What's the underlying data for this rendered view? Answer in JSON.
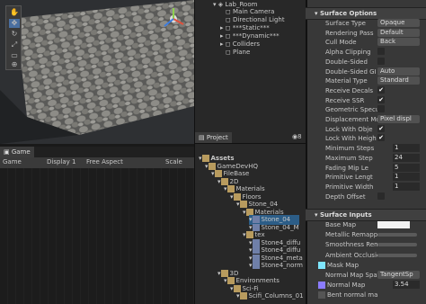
{
  "scene": {
    "tools": [
      "hand-tool",
      "move-tool",
      "rotate-tool",
      "scale-tool",
      "rect-tool",
      "transform-tool"
    ]
  },
  "game_tab": {
    "label": "Game",
    "display": "Game",
    "display_num": "Display 1",
    "aspect": "Free Aspect",
    "scale_label": "Scale"
  },
  "hierarchy": {
    "root": "Lab_Room",
    "items": [
      "Main Camera",
      "Directional Light",
      "***Static***",
      "***Dynamic***",
      "Colliders",
      "Plane"
    ]
  },
  "project": {
    "tab": "Project",
    "count": "8",
    "tree": [
      {
        "label": "Assets",
        "indent": 0,
        "bold": true
      },
      {
        "label": "GameDevHQ",
        "indent": 1
      },
      {
        "label": "FileBase",
        "indent": 2
      },
      {
        "label": "2D",
        "indent": 3
      },
      {
        "label": "Materials",
        "indent": 4
      },
      {
        "label": "Floors",
        "indent": 5
      },
      {
        "label": "Stone_04",
        "indent": 6
      },
      {
        "label": "Materials",
        "indent": 7
      },
      {
        "label": "Stone_04",
        "indent": 8,
        "selected": true
      },
      {
        "label": "Stone_04_M",
        "indent": 8
      },
      {
        "label": "tex",
        "indent": 7
      },
      {
        "label": "Stone4_diffu",
        "indent": 8
      },
      {
        "label": "Stone4_diffu",
        "indent": 8
      },
      {
        "label": "Stone4_meta",
        "indent": 8
      },
      {
        "label": "Stone4_norm",
        "indent": 8
      },
      {
        "label": "3D",
        "indent": 3
      },
      {
        "label": "Environments",
        "indent": 4
      },
      {
        "label": "Sci-Fi",
        "indent": 5
      },
      {
        "label": "Scifi_Columns_01",
        "indent": 6
      }
    ]
  },
  "inspector": {
    "surface_options_title": "Surface Options",
    "surface_options": [
      {
        "label": "Surface Type",
        "value": "Opaque"
      },
      {
        "label": "Rendering Pass",
        "value": "Default"
      },
      {
        "label": "Cull Mode",
        "value": "Back"
      },
      {
        "label": "Alpha Clipping",
        "check": false
      },
      {
        "label": "Double-Sided",
        "check": false
      },
      {
        "label": "Double-Sided GI",
        "value": "Auto"
      },
      {
        "label": "Material Type",
        "value": "Standard"
      },
      {
        "label": "Receive Decals",
        "check": true
      },
      {
        "label": "Receive SSR",
        "check": true
      },
      {
        "label": "Geometric Specul",
        "check": false
      },
      {
        "label": "Displacement Mod",
        "value": "Pixel displ"
      },
      {
        "label": "Lock With Obje",
        "check": true
      },
      {
        "label": "Lock With Heigh",
        "check": true
      },
      {
        "label": "Minimum Steps",
        "num": "1"
      },
      {
        "label": "Maximum Step",
        "num": "24"
      },
      {
        "label": "Fading Mip Le",
        "num": "5"
      },
      {
        "label": "Primitive Lengt",
        "num": "1"
      },
      {
        "label": "Primitive Width",
        "num": "1"
      },
      {
        "label": "Depth Offset",
        "check": false
      }
    ],
    "surface_inputs_title": "Surface Inputs",
    "surface_inputs": [
      {
        "label": "Base Map",
        "swatch": "#f2f2f2"
      },
      {
        "label": "Metallic Remappin",
        "slider": true
      },
      {
        "label": "Smoothness Rema",
        "slider": true
      },
      {
        "label": "Ambient Occlusion",
        "slider": true
      },
      {
        "label": "Mask Map",
        "tex": "#7fe6ff"
      },
      {
        "label": "Normal Map Spac",
        "value": "TangentSp"
      },
      {
        "label": "Normal Map",
        "tex": "#8b7cff",
        "num": "3.54"
      },
      {
        "label": "Bent normal ma",
        "tex": ""
      }
    ]
  }
}
